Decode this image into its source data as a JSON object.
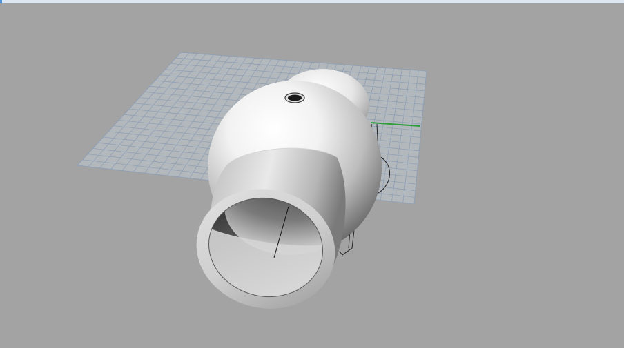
{
  "viewport": {
    "background_color": "#a3a3a3",
    "display_mode": "shaded",
    "grid_line_color": "#8f9fb3",
    "grid_plane_color": "#b3b8bd",
    "x_axis_color": "#c23b2e",
    "y_axis_color": "#2e9e3a",
    "objects": [
      {
        "name": "sphere",
        "color": "#e8e8e8"
      },
      {
        "name": "tube",
        "color": "#d9d9d9"
      },
      {
        "name": "drill-hole",
        "color": "#1a1a1a"
      }
    ]
  },
  "title_bar": {
    "color": "#dde6f1",
    "accent_color": "#4a90d9"
  }
}
